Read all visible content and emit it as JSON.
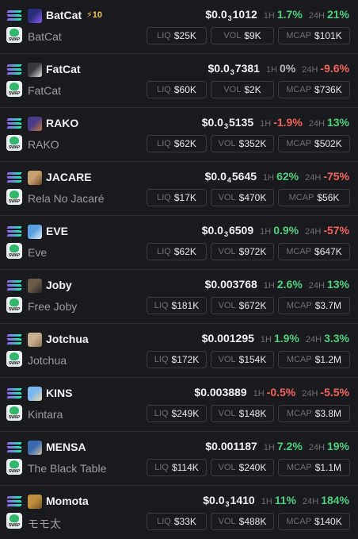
{
  "tokens": [
    {
      "symbol": "BatCat",
      "name": "BatCat",
      "boost": "⚡10",
      "price_pre": "$0.0",
      "price_sub": "3",
      "price_post": "1012",
      "h1": "1.7%",
      "h1_dir": "pos",
      "h24": "21%",
      "h24_dir": "pos",
      "liq": "$25K",
      "vol": "$9K",
      "mcap": "$101K",
      "avatar_colors": [
        "#2b2f7a",
        "#8a5cf5"
      ],
      "avatar_icon": "bat-cat-avatar-icon"
    },
    {
      "symbol": "FatCat",
      "name": "FatCat",
      "boost": "",
      "price_pre": "$0.0",
      "price_sub": "3",
      "price_post": "7381",
      "h1": "0%",
      "h1_dir": "zero",
      "h24": "-9.6%",
      "h24_dir": "neg",
      "liq": "$60K",
      "vol": "$2K",
      "mcap": "$736K",
      "avatar_colors": [
        "#3a3a3e",
        "#e8e8e8"
      ],
      "avatar_icon": "fat-cat-avatar-icon"
    },
    {
      "symbol": "RAKO",
      "name": "RAKO",
      "boost": "",
      "price_pre": "$0.0",
      "price_sub": "3",
      "price_post": "5135",
      "h1": "-1.9%",
      "h1_dir": "neg",
      "h24": "13%",
      "h24_dir": "pos",
      "liq": "$62K",
      "vol": "$352K",
      "mcap": "$502K",
      "avatar_colors": [
        "#4a3a8a",
        "#c07a3a"
      ],
      "avatar_icon": "rako-avatar-icon"
    },
    {
      "symbol": "JACARE",
      "name": "Rela No Jacaré",
      "boost": "",
      "price_pre": "$0.0",
      "price_sub": "4",
      "price_post": "5645",
      "h1": "62%",
      "h1_dir": "pos",
      "h24": "-75%",
      "h24_dir": "neg",
      "liq": "$17K",
      "vol": "$470K",
      "mcap": "$56K",
      "avatar_colors": [
        "#c8a070",
        "#6a4a2a"
      ],
      "avatar_icon": "jacare-avatar-icon"
    },
    {
      "symbol": "EVE",
      "name": "Eve",
      "boost": "",
      "price_pre": "$0.0",
      "price_sub": "3",
      "price_post": "6509",
      "h1": "0.9%",
      "h1_dir": "pos",
      "h24": "-57%",
      "h24_dir": "neg",
      "liq": "$62K",
      "vol": "$972K",
      "mcap": "$647K",
      "avatar_colors": [
        "#5aa0e0",
        "#e8f0f8"
      ],
      "avatar_icon": "eve-avatar-icon"
    },
    {
      "symbol": "Joby",
      "name": "Free Joby",
      "boost": "",
      "price_pre": "$0.003768",
      "price_sub": "",
      "price_post": "",
      "h1": "2.6%",
      "h1_dir": "pos",
      "h24": "13%",
      "h24_dir": "pos",
      "liq": "$181K",
      "vol": "$672K",
      "mcap": "$3.7M",
      "avatar_colors": [
        "#6a5a4a",
        "#2a2a2a"
      ],
      "avatar_icon": "joby-avatar-icon"
    },
    {
      "symbol": "Jotchua",
      "name": "Jotchua",
      "boost": "",
      "price_pre": "$0.001295",
      "price_sub": "",
      "price_post": "",
      "h1": "1.9%",
      "h1_dir": "pos",
      "h24": "3.3%",
      "h24_dir": "pos",
      "liq": "$172K",
      "vol": "$154K",
      "mcap": "$1.2M",
      "avatar_colors": [
        "#c8b090",
        "#8a7050"
      ],
      "avatar_icon": "jotchua-avatar-icon"
    },
    {
      "symbol": "KINS",
      "name": "Kintara",
      "boost": "",
      "price_pre": "$0.003889",
      "price_sub": "",
      "price_post": "",
      "h1": "-0.5%",
      "h1_dir": "neg",
      "h24": "-5.5%",
      "h24_dir": "neg",
      "liq": "$249K",
      "vol": "$148K",
      "mcap": "$3.8M",
      "avatar_colors": [
        "#7ab8f0",
        "#f0d8a8"
      ],
      "avatar_icon": "kins-avatar-icon"
    },
    {
      "symbol": "MENSA",
      "name": "The Black Table",
      "boost": "",
      "price_pre": "$0.001187",
      "price_sub": "",
      "price_post": "",
      "h1": "7.2%",
      "h1_dir": "pos",
      "h24": "19%",
      "h24_dir": "pos",
      "liq": "$114K",
      "vol": "$240K",
      "mcap": "$1.1M",
      "avatar_colors": [
        "#3a6ab0",
        "#d0c0a0"
      ],
      "avatar_icon": "mensa-avatar-icon"
    },
    {
      "symbol": "Momota",
      "name": "モモ太",
      "boost": "",
      "price_pre": "$0.0",
      "price_sub": "3",
      "price_post": "1410",
      "h1": "11%",
      "h1_dir": "pos",
      "h24": "184%",
      "h24_dir": "pos",
      "liq": "$33K",
      "vol": "$488K",
      "mcap": "$140K",
      "avatar_colors": [
        "#c09040",
        "#7a5020"
      ],
      "avatar_icon": "momota-avatar-icon"
    }
  ],
  "labels": {
    "h1": "1H",
    "h24": "24H",
    "liq": "LIQ",
    "vol": "VOL",
    "mcap": "MCAP",
    "swap": "SWAP"
  },
  "colors": {
    "positive": "#4cd07d",
    "negative": "#f3625a",
    "background": "#1a1b1f"
  }
}
